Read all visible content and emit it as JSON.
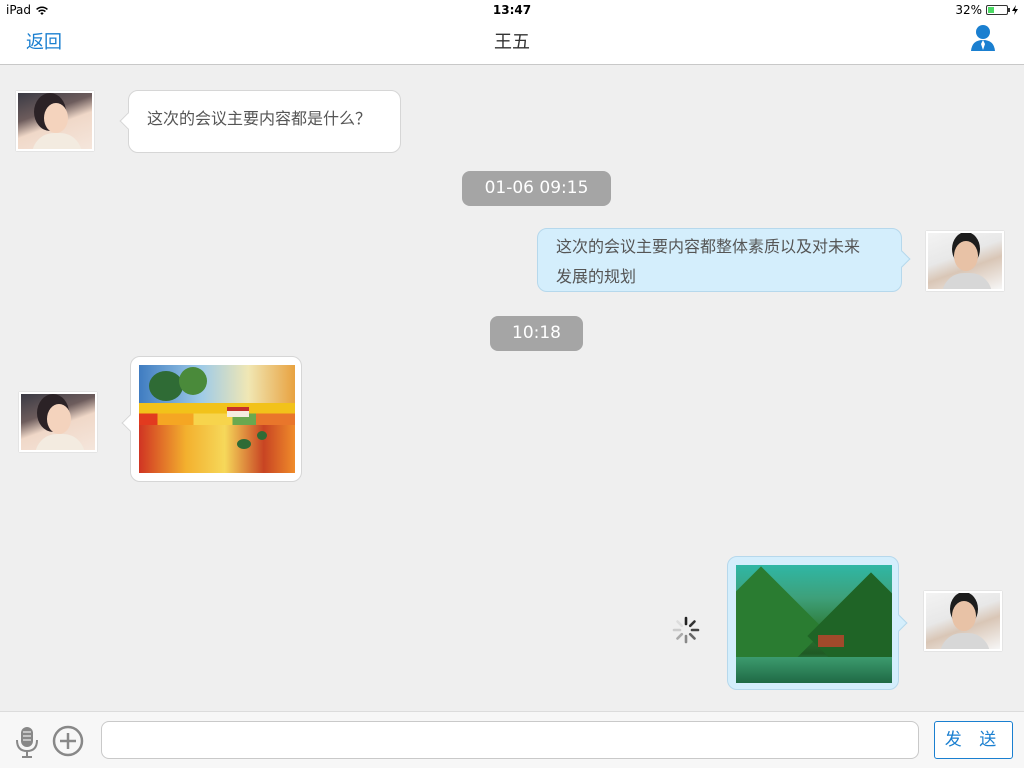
{
  "status_bar": {
    "carrier": "iPad",
    "time": "13:47",
    "battery": "32%",
    "battery_level": 0.32
  },
  "nav": {
    "back_label": "返回",
    "title": "王五",
    "profile_icon": "person-icon",
    "accent": "#1a7fd0"
  },
  "messages": [
    {
      "type": "text",
      "direction": "in",
      "text": "这次的会议主要内容都是什么？"
    },
    {
      "type": "timestamp",
      "text": "01-06 09:15"
    },
    {
      "type": "text",
      "direction": "out",
      "lines": [
        "这次的会议主要内容都整体素质以及对未来",
        "发展的规划"
      ]
    },
    {
      "type": "timestamp",
      "text": "10:18"
    },
    {
      "type": "image",
      "direction": "in",
      "image": "landscape-painting"
    },
    {
      "type": "image",
      "direction": "out",
      "image": "mountain-lake-photo",
      "status": "sending"
    }
  ],
  "input_bar": {
    "mic_icon": "microphone-icon",
    "add_icon": "plus-circle-icon",
    "input_value": "",
    "send_label": "发 送"
  }
}
